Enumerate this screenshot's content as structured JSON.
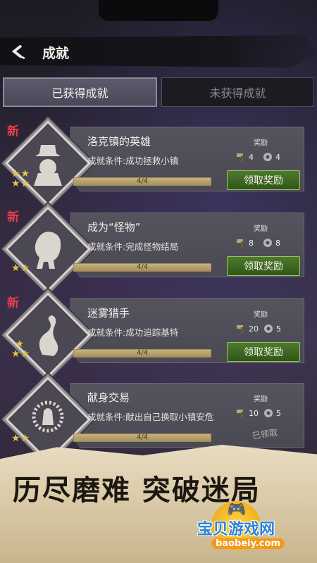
{
  "header": {
    "title": "成就",
    "back_icon": "chevron-left-icon"
  },
  "tabs": [
    {
      "label": "已获得成就",
      "active": true
    },
    {
      "label": "未获得成就",
      "active": false
    }
  ],
  "reward_label": "奖励",
  "claim_label": "领取奖励",
  "new_label": "新",
  "achievements": [
    {
      "name": "洛克镇的英雄",
      "condition": "成就条件:成功拯救小镇",
      "progress_text": "4/4",
      "progress": 1.0,
      "reward_a": "4",
      "reward_b": "4",
      "stars": 3,
      "is_new": true,
      "emblem": "detective-hat-icon"
    },
    {
      "name": "成为“怪物”",
      "condition": "成就条件:完成怪物结局",
      "progress_text": "4/4",
      "progress": 1.0,
      "reward_a": "8",
      "reward_b": "8",
      "stars": 2,
      "is_new": true,
      "emblem": "beast-icon"
    },
    {
      "name": "迷雾猎手",
      "condition": "成就条件:成功追踪基特",
      "progress_text": "4/4",
      "progress": 1.0,
      "reward_a": "20",
      "reward_b": "5",
      "stars": 3,
      "is_new": true,
      "emblem": "serpent-icon"
    },
    {
      "name": "献身交易",
      "condition": "成就条件:献出自己换取小镇安危",
      "progress_text": "4/4",
      "progress": 1.0,
      "reward_a": "10",
      "reward_b": "5",
      "stars": 2,
      "is_new": false,
      "emblem": "sacrifice-icon",
      "status": "已领取"
    }
  ],
  "banner": {
    "slogan": "历尽磨难 突破迷局"
  },
  "watermark": {
    "title": "宝贝游戏网",
    "url": "baobeiy.com"
  },
  "colors": {
    "accent_green": "#3f6a22",
    "new_red": "#e33e4d",
    "star_gold": "#e6c34a",
    "progress_gold": "#b8a06a"
  }
}
